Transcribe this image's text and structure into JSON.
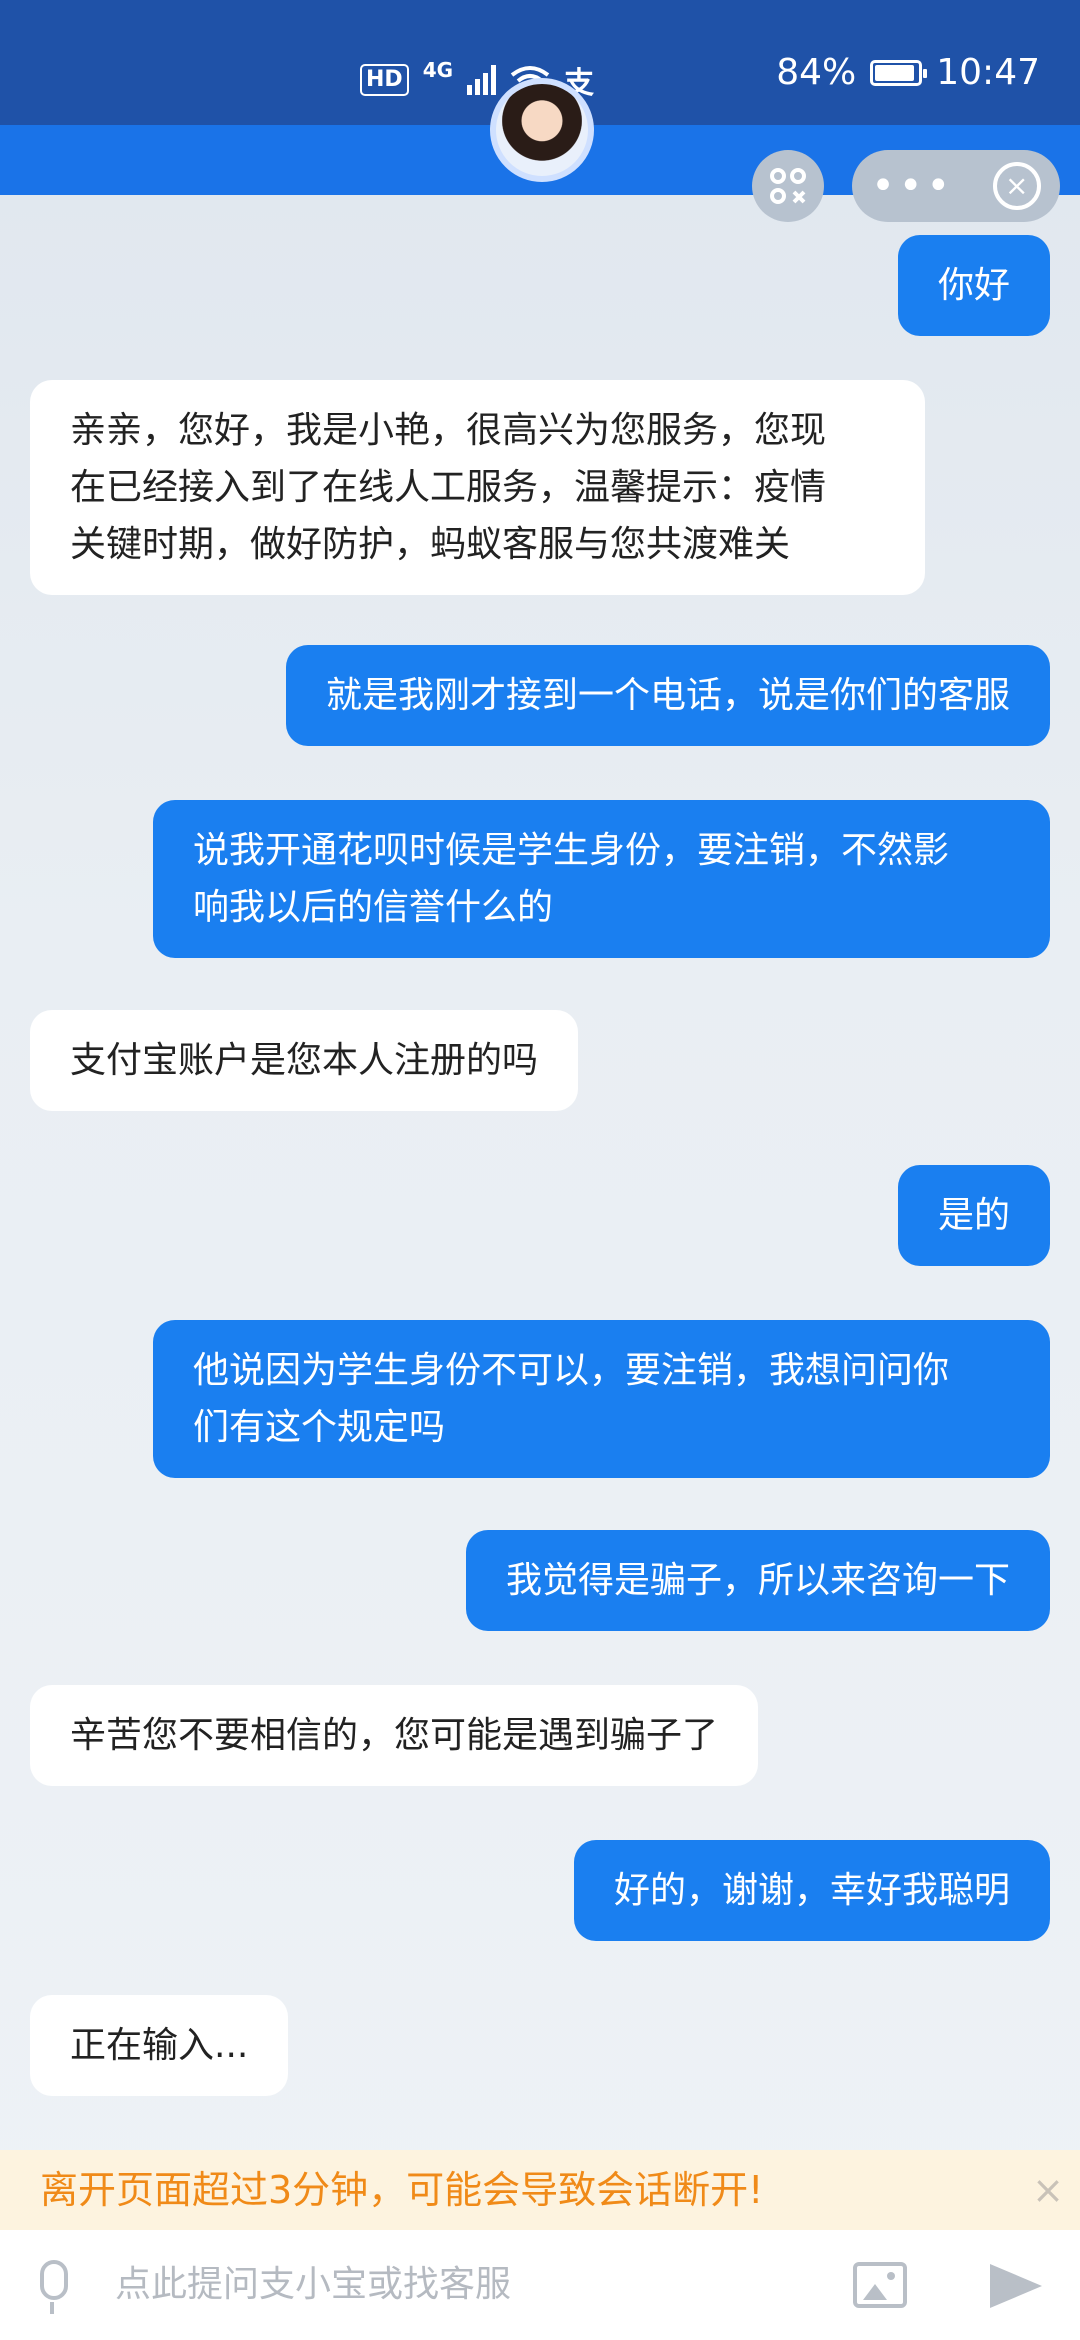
{
  "status_bar": {
    "hd": "HD",
    "network": "4G",
    "alipay_glyph": "支",
    "battery": "84%",
    "time": "10:47"
  },
  "header": {
    "avatar_icon": "agent-avatar",
    "scan_icon": "scan-icon",
    "menu_dots": "•••",
    "close_glyph": "×"
  },
  "messages": [
    {
      "from": "user",
      "text": "你好"
    },
    {
      "from": "bot",
      "lines": [
        "亲亲，您好，我是小艳，很高兴为您服务，您现",
        "在已经接入到了在线人工服务，温馨提示：疫情",
        "关键时期，做好防护，蚂蚁客服与您共渡难关"
      ]
    },
    {
      "from": "user",
      "text": "就是我刚才接到一个电话，说是你们的客服"
    },
    {
      "from": "user",
      "lines": [
        "说我开通花呗时候是学生身份，要注销，不然影",
        "响我以后的信誉什么的"
      ]
    },
    {
      "from": "bot",
      "text": "支付宝账户是您本人注册的吗"
    },
    {
      "from": "user",
      "text": "是的"
    },
    {
      "from": "user",
      "lines": [
        "他说因为学生身份不可以，要注销，我想问问你",
        "们有这个规定吗"
      ]
    },
    {
      "from": "user",
      "text": "我觉得是骗子，所以来咨询一下"
    },
    {
      "from": "bot",
      "text": "辛苦您不要相信的，您可能是遇到骗子了"
    },
    {
      "from": "user",
      "text": "好的，谢谢，幸好我聪明"
    },
    {
      "from": "bot",
      "text": "正在输入..."
    }
  ],
  "warning": {
    "text": "离开页面超过3分钟，可能会导致会话断开!",
    "close": "×",
    "color": "#f08a18"
  },
  "input": {
    "placeholder": "点此提问支小宝或找客服"
  },
  "colors": {
    "user_bubble": "#1a7ff0",
    "bot_bubble": "#ffffff",
    "header": "#1f52a8"
  }
}
